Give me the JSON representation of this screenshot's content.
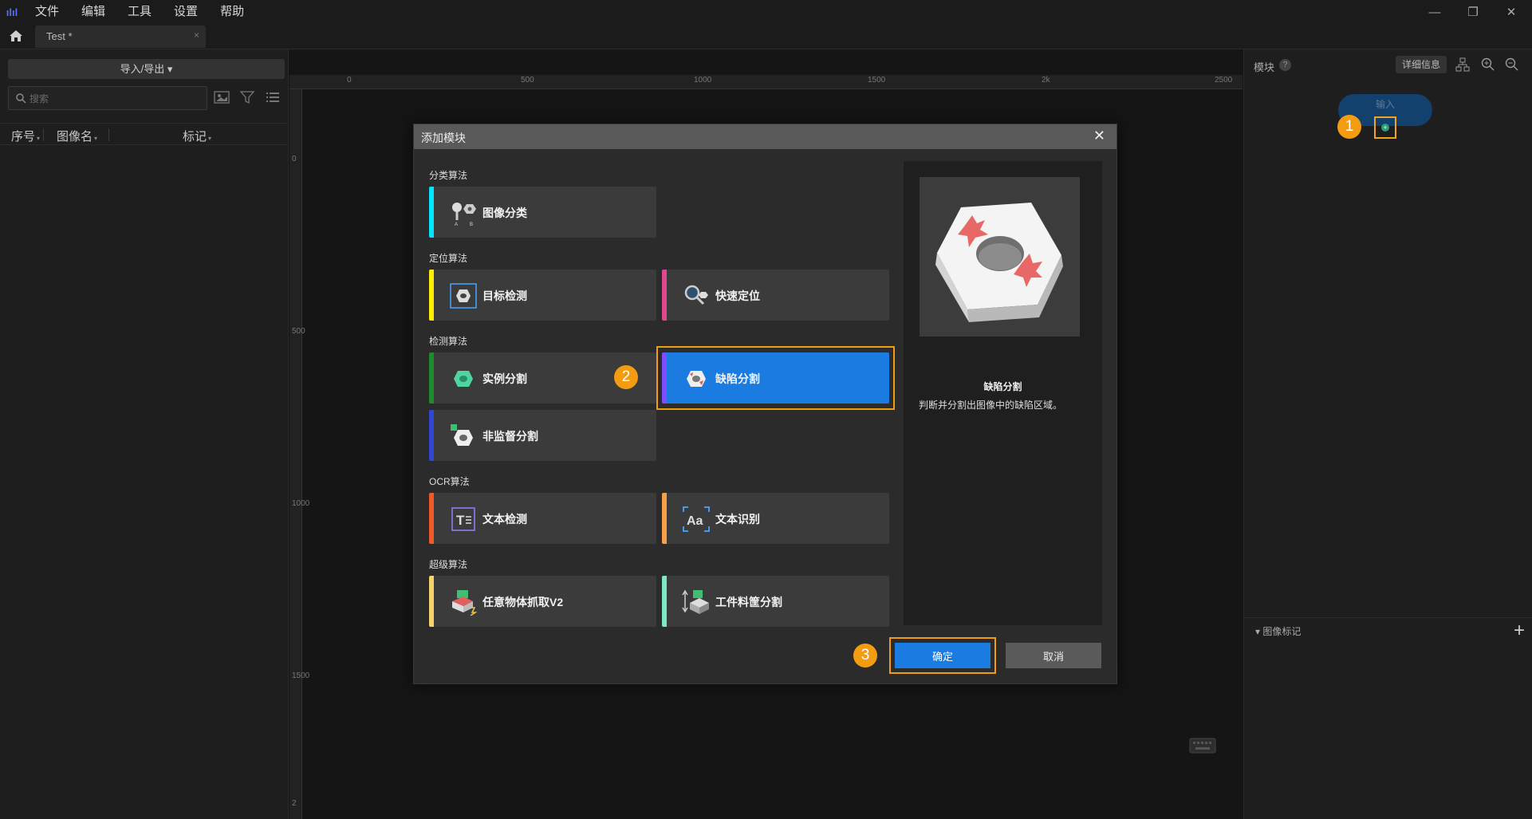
{
  "app": {
    "logo_text": "ılıl",
    "menu": [
      "文件",
      "编辑",
      "工具",
      "设置",
      "帮助"
    ]
  },
  "tabs": [
    {
      "title": "Test *",
      "close": "×"
    }
  ],
  "left_panel": {
    "import_export_label": "导入/导出 ▾",
    "search_placeholder": "搜索",
    "columns": [
      "序号",
      "图像名",
      "标记"
    ]
  },
  "canvas": {
    "ruler_top_ticks": [
      "0",
      "500",
      "1000",
      "1500",
      "2k",
      "2500"
    ],
    "ruler_left_ticks": [
      "0",
      "500",
      "1000",
      "1500",
      "2"
    ]
  },
  "right_panel": {
    "title": "模块",
    "help": "?",
    "detail_button": "详细信息",
    "input_node_label": "输入",
    "plus": "+",
    "bottom_title": "▾ 图像标记",
    "bottom_add": "+"
  },
  "dialog": {
    "title": "添加模块",
    "close": "✕",
    "sections": [
      {
        "label": "分类算法",
        "modules": [
          {
            "name": "图像分类",
            "color": "#00e5ff"
          }
        ]
      },
      {
        "label": "定位算法",
        "modules": [
          {
            "name": "目标检测",
            "color": "#ffee00"
          },
          {
            "name": "快速定位",
            "color": "#e0478f"
          }
        ]
      },
      {
        "label": "检测算法",
        "modules": [
          {
            "name": "实例分割",
            "color": "#1e8a2e"
          },
          {
            "name": "缺陷分割",
            "color": "#7c4dff",
            "selected": true
          },
          {
            "name": "非监督分割",
            "color": "#3047d6"
          }
        ]
      },
      {
        "label": "OCR算法",
        "modules": [
          {
            "name": "文本检测",
            "color": "#f05a28"
          },
          {
            "name": "文本识别",
            "color": "#f7a04a"
          }
        ]
      },
      {
        "label": "超级算法",
        "modules": [
          {
            "name": "任意物体抓取V2",
            "color": "#f7d26a"
          },
          {
            "name": "工件料筐分割",
            "color": "#7ee8c4"
          }
        ]
      }
    ],
    "preview": {
      "name": "缺陷分割",
      "description": "判断并分割出图像中的缺陷区域。"
    },
    "ok_label": "确定",
    "cancel_label": "取消"
  },
  "badges": [
    "1",
    "2",
    "3"
  ],
  "colors": {
    "accent": "#1a7be0",
    "highlight": "#f39c12",
    "background": "#151515"
  }
}
